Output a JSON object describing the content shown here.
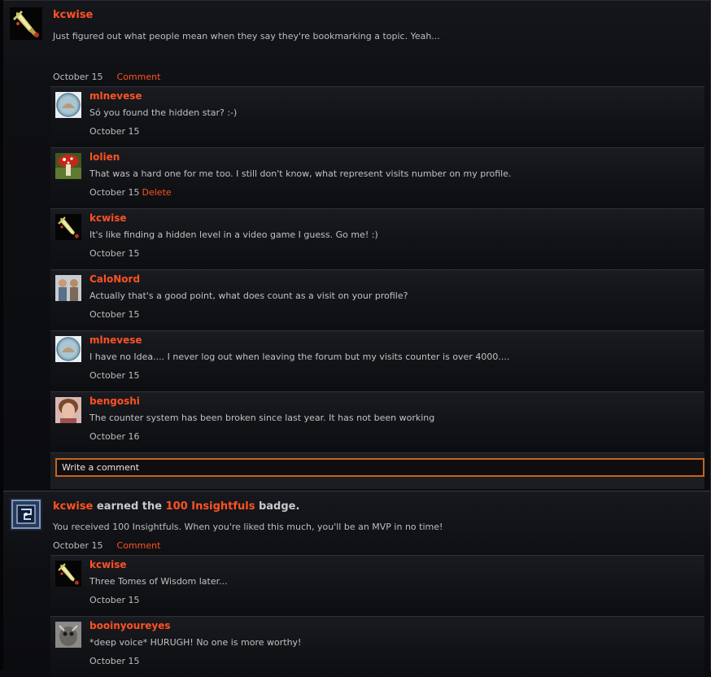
{
  "posts": [
    {
      "author": "kcwise",
      "body": "Just figured out what people mean when they say they're bookmarking a topic. Yeah...",
      "date": "October 15",
      "comment_label": "Comment",
      "comments": [
        {
          "name": "mlnevese",
          "text": "Só you found the hidden star? :-)",
          "date": "October 15"
        },
        {
          "name": "lolien",
          "text": "That was a hard one for me too. I still don't know, what represent visits number on my profile.",
          "date": "October 15",
          "delete_label": "Delete"
        },
        {
          "name": "kcwise",
          "text": "It's like finding a hidden level in a video game I guess. Go me! :)",
          "date": "October 15"
        },
        {
          "name": "CaloNord",
          "text": "Actually that's a good point, what does count as a visit on your profile?",
          "date": "October 15"
        },
        {
          "name": "mlnevese",
          "text": "I have no Idea.... I never log out when leaving the forum but my visits counter is over 4000....",
          "date": "October 15"
        },
        {
          "name": "bengoshi",
          "text": "The counter system has been broken since last year. It has not been working",
          "date": "October 16"
        }
      ],
      "write_placeholder": "Write a comment"
    },
    {
      "author": "kcwise",
      "earned_text": " earned the ",
      "badge_name": "100 Insightfuls",
      "badge_suffix": " badge.",
      "body": "You received 100 Insightfuls. When you're liked this much, you'll be an MVP in no time!",
      "date": "October 15",
      "comment_label": "Comment",
      "comments": [
        {
          "name": "kcwise",
          "text": "Three Tomes of Wisdom later...",
          "date": "October 15"
        },
        {
          "name": "booinyoureyes",
          "text": "*deep voice* HURUGH! No one is more worthy!",
          "date": "October 15"
        }
      ]
    }
  ],
  "colors": {
    "accent": "#ff5222",
    "input_border": "#c8641a"
  }
}
